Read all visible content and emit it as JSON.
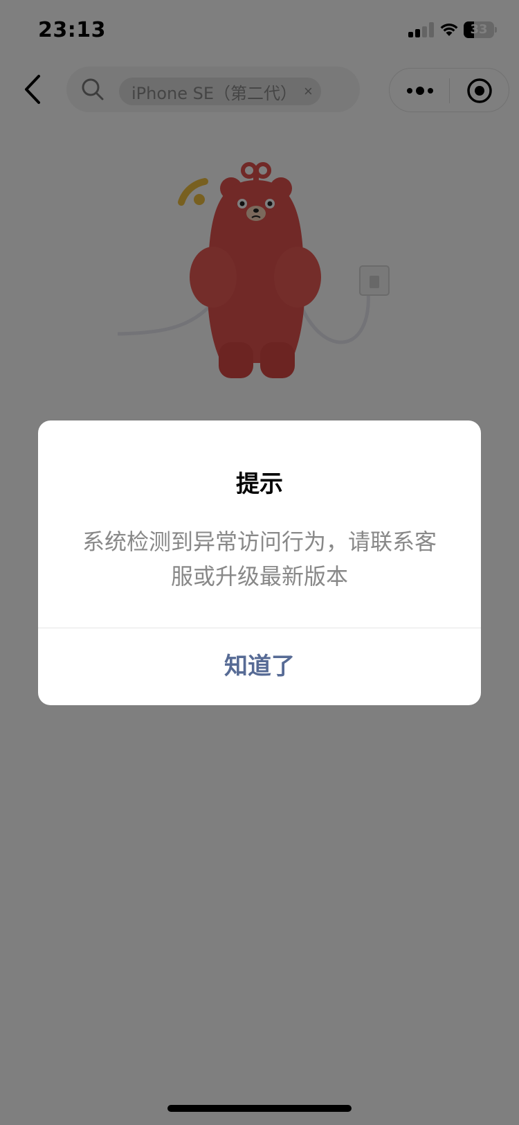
{
  "status_bar": {
    "time": "23:13",
    "battery_level": "33",
    "battery_fraction": 0.33,
    "signal_bars_active": 2,
    "signal_bars_total": 4
  },
  "nav": {
    "search_chip_label": "iPhone SE（第二代）",
    "search_chip_close": "×"
  },
  "dialog": {
    "title": "提示",
    "message": "系统检测到异常访问行为，请联系客服或升级最新版本",
    "confirm_label": "知道了"
  },
  "colors": {
    "dialog_action": "#576b95",
    "message_text": "#888888",
    "overlay": "rgba(0,0,0,0.5)",
    "mascot": "#e2524e",
    "wifi_fragment": "#f0c040"
  },
  "icons": {
    "back": "chevron-left-icon",
    "search": "search-icon",
    "more": "more-dots-icon",
    "close_target": "close-target-icon",
    "mascot": "bear-mascot-illustration"
  }
}
